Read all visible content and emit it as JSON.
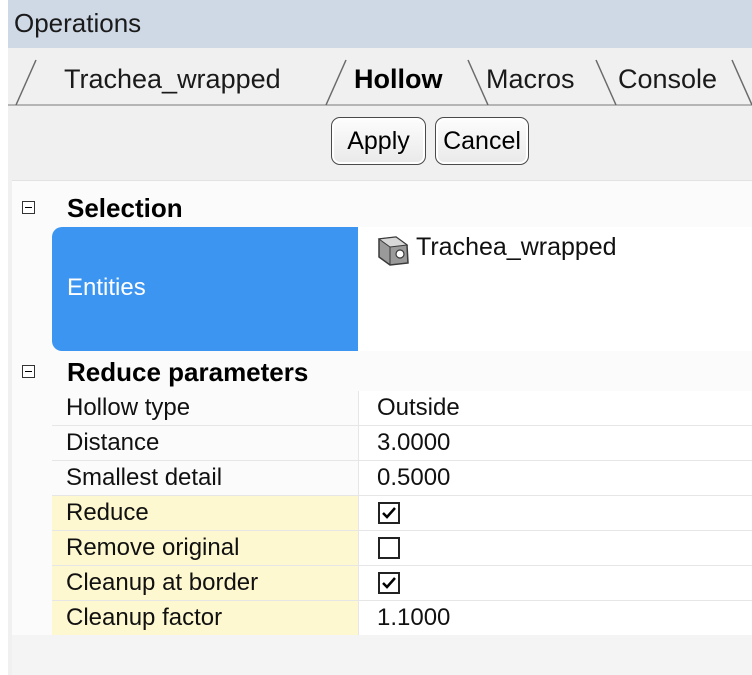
{
  "window": {
    "title": "Operations"
  },
  "tabs": [
    {
      "label": "Trachea_wrapped",
      "active": false
    },
    {
      "label": "Hollow",
      "active": true
    },
    {
      "label": "Macros",
      "active": false
    },
    {
      "label": "Console",
      "active": false
    }
  ],
  "actions": {
    "apply_label": "Apply",
    "cancel_label": "Cancel"
  },
  "selection": {
    "category": "Selection",
    "entities_label": "Entities",
    "entities_value": "Trachea_wrapped",
    "entity_icon": "part-icon"
  },
  "reduce_parameters": {
    "category": "Reduce parameters",
    "rows": [
      {
        "name": "Hollow type",
        "value": "Outside"
      },
      {
        "name": "Distance",
        "value": "3.0000"
      },
      {
        "name": "Smallest detail",
        "value": "0.5000"
      },
      {
        "name": "Reduce",
        "checked": true
      },
      {
        "name": "Remove original",
        "checked": false
      },
      {
        "name": "Cleanup at border",
        "checked": true
      },
      {
        "name": "Cleanup factor",
        "value": "1.1000"
      }
    ]
  },
  "colors": {
    "selection_highlight": "#3d95f2",
    "boolean_row_highlight": "#fdf8d0"
  }
}
